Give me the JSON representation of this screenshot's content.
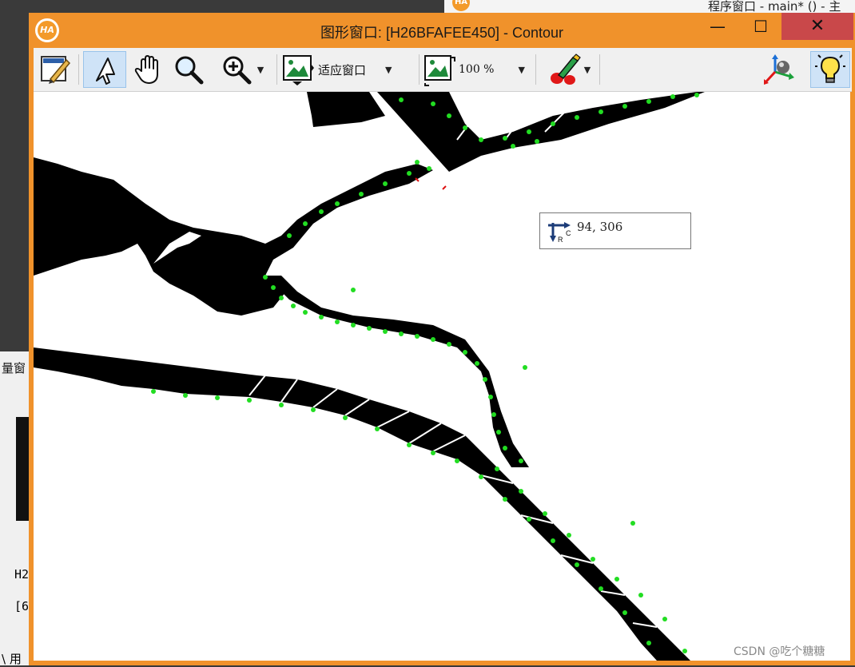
{
  "background": {
    "top_window_title": "程序窗口 - main* () - 主",
    "left_panel_label": "量窗",
    "left_text_1": "H2",
    "left_text_2": "[6",
    "left_text_3": "\\ 用"
  },
  "window": {
    "title": "图形窗口: [H26BFAFEE450] - Contour",
    "minimize_glyph": "—",
    "maximize_glyph": "☐",
    "close_glyph": "✕"
  },
  "toolbar": {
    "fit_label": "适应窗口",
    "zoom_label": "100 %"
  },
  "tooltip": {
    "coords": "94,  306"
  },
  "watermark": "CSDN @吃个糖糖",
  "colors": {
    "window_frame": "#f0922b",
    "close_button": "#c9484a",
    "contour_points": "#22dd22",
    "region_fill": "#000000"
  }
}
